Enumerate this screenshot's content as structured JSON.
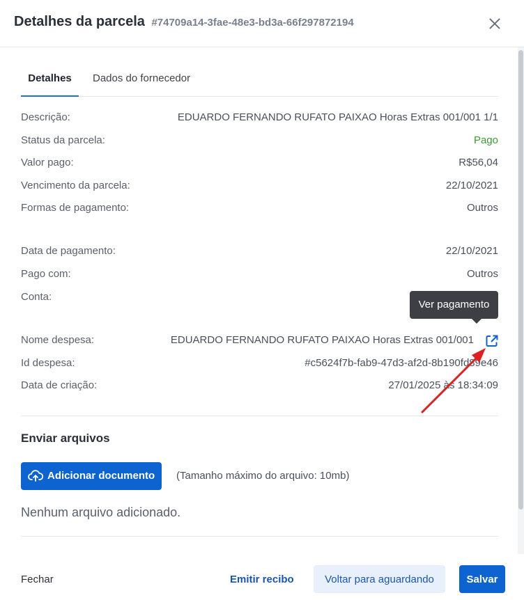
{
  "header": {
    "title": "Detalhes da parcela",
    "id": "#74709a14-3fae-48e3-bd3a-66f297872194"
  },
  "tabs": [
    {
      "label": "Detalhes",
      "active": true
    },
    {
      "label": "Dados do fornecedor",
      "active": false
    }
  ],
  "details": {
    "descricao": {
      "label": "Descrição:",
      "value": "EDUARDO FERNANDO RUFATO PAIXAO Horas Extras 001/001 1/1"
    },
    "status": {
      "label": "Status da parcela:",
      "value": "Pago"
    },
    "valor": {
      "label": "Valor pago:",
      "value": "R$56,04"
    },
    "vencimento": {
      "label": "Vencimento da parcela:",
      "value": "22/10/2021"
    },
    "formas": {
      "label": "Formas de pagamento:",
      "value": "Outros"
    },
    "data_pagamento": {
      "label": "Data de pagamento:",
      "value": "22/10/2021"
    },
    "pago_com": {
      "label": "Pago com:",
      "value": "Outros"
    },
    "conta": {
      "label": "Conta:",
      "value": ""
    },
    "nome_despesa": {
      "label": "Nome despesa:",
      "value": "EDUARDO FERNANDO RUFATO PAIXAO Horas Extras 001/001"
    },
    "id_despesa": {
      "label": "Id despesa:",
      "value": "#c5624f7b-fab9-47d3-af2d-8b190fd89e46"
    },
    "data_criacao": {
      "label": "Data de criação:",
      "value": "27/01/2025 às 18:34:09"
    }
  },
  "tooltip": {
    "text": "Ver pagamento"
  },
  "files": {
    "title": "Enviar arquivos",
    "add_button": "Adicionar documento",
    "max_size": "(Tamanho máximo do arquivo: 10mb)",
    "empty": "Nenhum arquivo adicionado."
  },
  "footer": {
    "close": "Fechar",
    "receipt": "Emitir recibo",
    "back": "Voltar para aguardando",
    "save": "Salvar"
  },
  "colors": {
    "primary": "#0d63d0",
    "status_paid": "#3f9a37",
    "annotation": "#e02020"
  }
}
